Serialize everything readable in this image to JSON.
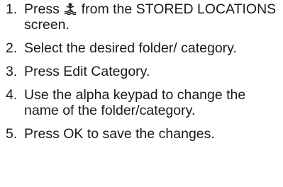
{
  "steps": [
    {
      "number": "1.",
      "text_before_icon": "Press ",
      "icon": "person-overboard-icon",
      "text_after_icon": " from the STORED LOCATIONS screen."
    },
    {
      "number": "2.",
      "text": "Select the desired folder/ category."
    },
    {
      "number": "3.",
      "text": "Press Edit Category."
    },
    {
      "number": "4.",
      "text": "Use the alpha keypad to change the name of the folder/category."
    },
    {
      "number": "5.",
      "text": "Press OK to save the changes."
    }
  ]
}
